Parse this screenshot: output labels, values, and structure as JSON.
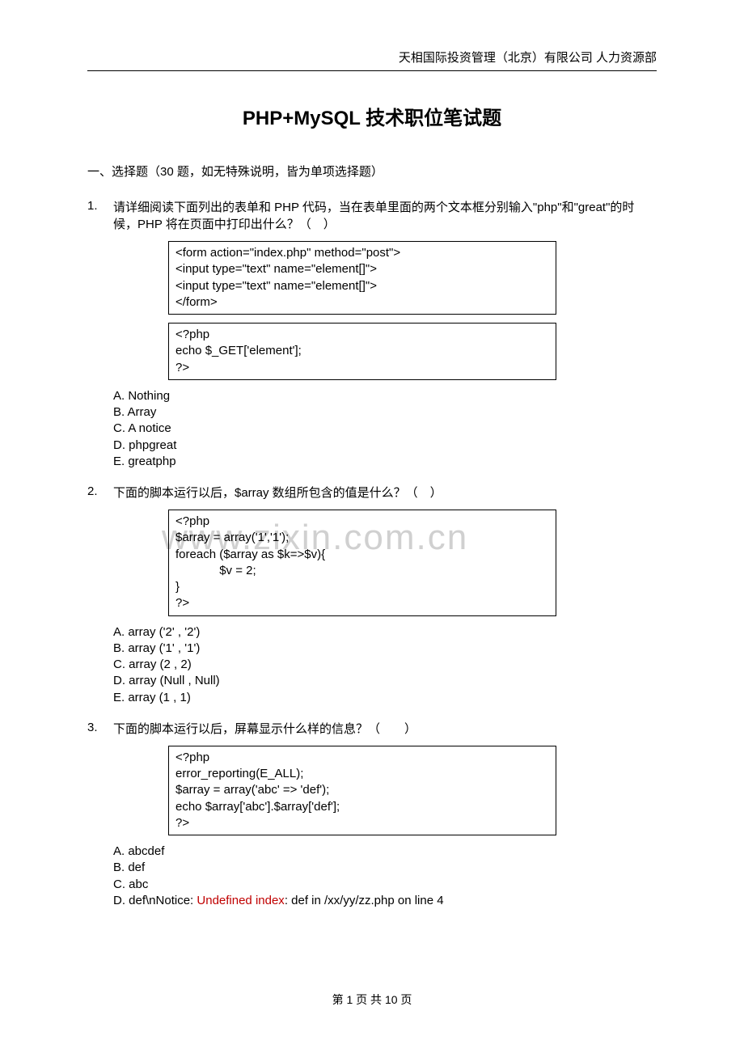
{
  "header": {
    "company": "天相国际投资管理（北京）有限公司  人力资源部"
  },
  "title": "PHP+MySQL 技术职位笔试题",
  "section_intro": "一、选择题（30 题，如无特殊说明，皆为单项选择题）",
  "q1": {
    "num": "1.",
    "text": "请详细阅读下面列出的表单和 PHP 代码，当在表单里面的两个文本框分别输入\"php\"和\"great\"的时候，PHP 将在页面中打印出什么？（　）",
    "code1": "<form action=\"index.php\" method=\"post\">\n<input type=\"text\" name=\"element[]\">\n<input type=\"text\" name=\"element[]\">\n</form>",
    "code2": "<?php\necho $_GET['element'];\n?>",
    "opts": {
      "a": "A. Nothing",
      "b": "B. Array",
      "c": "C. A notice",
      "d": "D. phpgreat",
      "e": "E. greatphp"
    }
  },
  "q2": {
    "num": "2.",
    "text": "下面的脚本运行以后，$array 数组所包含的值是什么？（　）",
    "code": "<?php\n$array = array('1','1');\nforeach ($array as $k=>$v){\n             $v = 2;\n}\n?>",
    "opts": {
      "a": "A. array ('2' , '2')",
      "b": "B. array ('1' , '1')",
      "c": "C. array (2 , 2)",
      "d": "D. array (Null , Null)",
      "e": "E. array (1 , 1)"
    }
  },
  "q3": {
    "num": "3.",
    "text": "下面的脚本运行以后，屏幕显示什么样的信息？（　　）",
    "code": "<?php\nerror_reporting(E_ALL);\n$array = array('abc' => 'def');\necho $array['abc'].$array['def'];\n?>",
    "opts": {
      "a": "A. abcdef",
      "b": "B. def",
      "c": "C. abc",
      "d_pre": "D. def\\nNotice: ",
      "d_red": "Undefined index",
      "d_post": ": def in /xx/yy/zz.php on line 4"
    }
  },
  "watermark": "www.zixin.com.cn",
  "footer": "第  1  页  共  10  页"
}
